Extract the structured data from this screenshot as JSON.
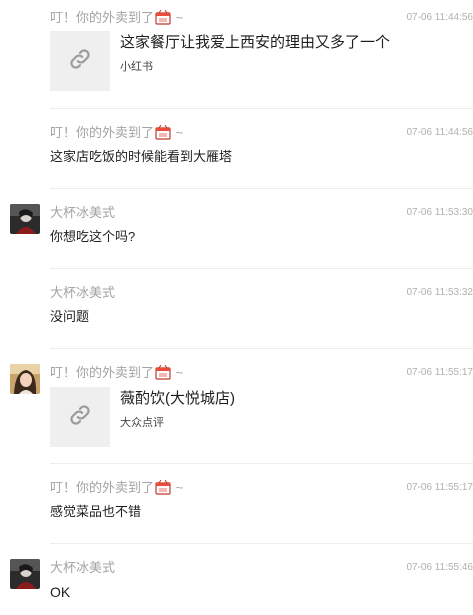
{
  "messages": [
    {
      "sender": "叮！你的外卖到了",
      "sender_suffix": "~",
      "sender_icon": "takeout-box-emoji",
      "time": "07-06 11:44:56",
      "link": {
        "title": "这家餐厅让我爱上西安的理由又多了一个",
        "source": "小红书",
        "icon": "link-icon"
      }
    },
    {
      "sender": "叮！你的外卖到了",
      "sender_suffix": "~",
      "sender_icon": "takeout-box-emoji",
      "time": "07-06 11:44:56",
      "text": "这家店吃饭的时候能看到大雁塔"
    },
    {
      "sender": "大杯冰美式",
      "time": "07-06 11:53:30",
      "text": "你想吃这个吗?",
      "avatar": "dark-avatar"
    },
    {
      "sender": "大杯冰美式",
      "time": "07-06 11:53:32",
      "text": "没问题"
    },
    {
      "sender": "叮！你的外卖到了",
      "sender_suffix": "~",
      "sender_icon": "takeout-box-emoji",
      "time": "07-06 11:55:17",
      "avatar": "girl-avatar",
      "link": {
        "title": "薇酌饮(大悦城店)",
        "source": "大众点评",
        "icon": "link-icon"
      }
    },
    {
      "sender": "叮！你的外卖到了",
      "sender_suffix": "~",
      "sender_icon": "takeout-box-emoji",
      "time": "07-06 11:55:17",
      "text": "感觉菜品也不错"
    },
    {
      "sender": "大杯冰美式",
      "time": "07-06 11:55:46",
      "text": "OK",
      "avatar": "dark-avatar"
    }
  ]
}
